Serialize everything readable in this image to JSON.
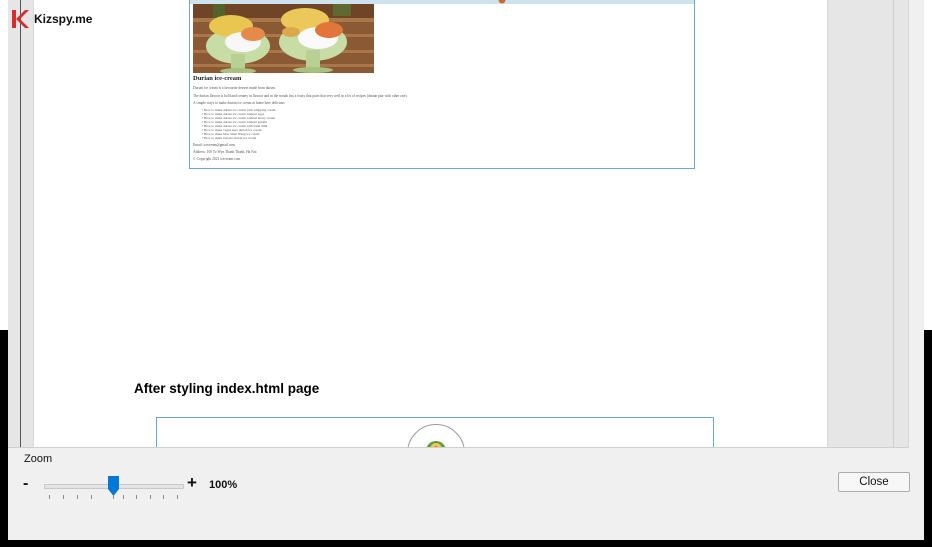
{
  "watermark": {
    "brand": "Kizspy.me",
    "brand_color": "#d62e2e"
  },
  "document": {
    "inner_screenshot": {
      "title": "Durian ice-cream",
      "paragraphs": [
        "Durian ice cream is a favourite dessert made from durian.",
        "The durian flavour is bold and creamy in flavour and in the mouth has a fruity that pairs that very well in a lot of recipes (durian pair with other one).",
        "A simple ways to make durian ice cream at home here delicious"
      ],
      "list_items": [
        "How to make durian ice cream with whipping cream",
        "How to make durian ice cream without eggs",
        "How to make durian ice cream without heavy cream",
        "How to make durian ice cream without gelatin",
        "How to make durian ice cream with fresh milk",
        "How to make vegan keto durian ice cream",
        "How to make Mao Shan Wang ice cream",
        "How to make banana durian ice cream"
      ],
      "email_line": "Email: icecream@gmail.com",
      "address_line": "Address: 100 To Wyn Thanh Thanh, Ha Noi",
      "copyright_line": "© Copyright 2021 icecream.com"
    },
    "section_heading": "After styling index.html page"
  },
  "zoom": {
    "label": "Zoom",
    "minus": "-",
    "plus": "+",
    "value_text": "100%",
    "level": 0.5,
    "accent_color": "#0078d7"
  },
  "buttons": {
    "close": "Close"
  }
}
